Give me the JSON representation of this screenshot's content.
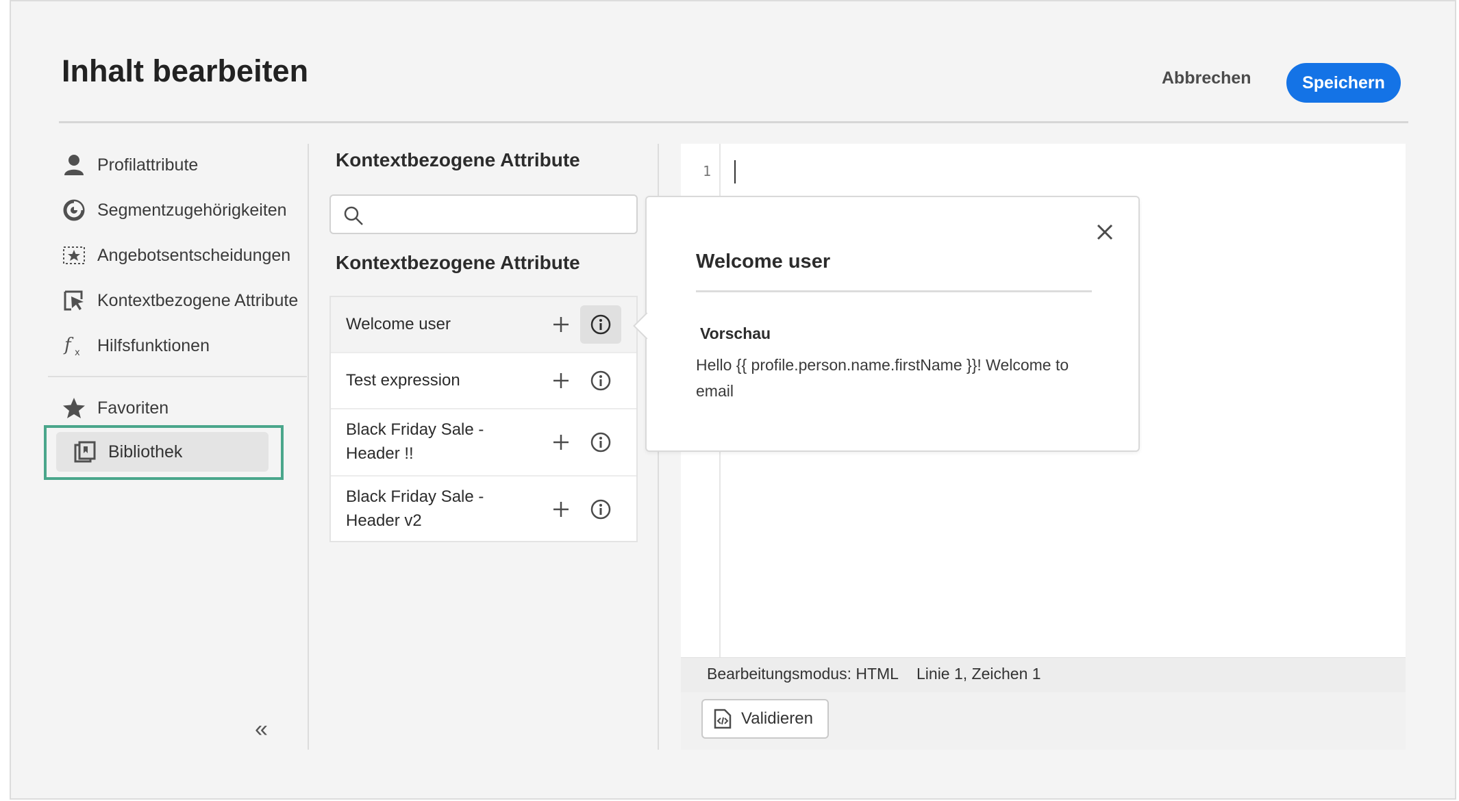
{
  "header": {
    "title": "Inhalt bearbeiten",
    "cancel_label": "Abbrechen",
    "save_label": "Speichern"
  },
  "sidebar": {
    "items": [
      {
        "label": "Profilattribute",
        "icon": "person-icon"
      },
      {
        "label": "Segmentzugehörigkeiten",
        "icon": "segment-icon"
      },
      {
        "label": "Angebotsentscheidungen",
        "icon": "offer-star-icon"
      },
      {
        "label": "Kontextbezogene Attribute",
        "icon": "contextual-pointer-icon"
      },
      {
        "label": "Hilfsfunktionen",
        "icon": "function-fx-icon"
      }
    ],
    "favorites_label": "Favoriten",
    "library_label": "Bibliothek",
    "collapse_glyph": "«",
    "highlight_color": "#4aa68b"
  },
  "middle": {
    "heading": "Kontextbezogene Attribute",
    "search_placeholder": "",
    "subheading": "Kontextbezogene Attribute",
    "rows": [
      {
        "label": "Welcome user",
        "selected": true
      },
      {
        "label": "Test expression",
        "selected": false
      },
      {
        "label": "Black Friday Sale - Header !!",
        "selected": false
      },
      {
        "label": "Black Friday Sale - Header v2",
        "selected": false
      }
    ]
  },
  "editor": {
    "line_number": "1",
    "status_mode": "Bearbeitungsmodus: HTML",
    "status_position": "Linie 1, Zeichen 1",
    "validate_label": "Validieren"
  },
  "popover": {
    "title": "Welcome user",
    "preview_label": "Vorschau",
    "preview_text": "Hello {{ profile.person.name.firstName }}! Welcome to email"
  },
  "colors": {
    "accent": "#1473e6",
    "background": "#f4f4f4"
  }
}
